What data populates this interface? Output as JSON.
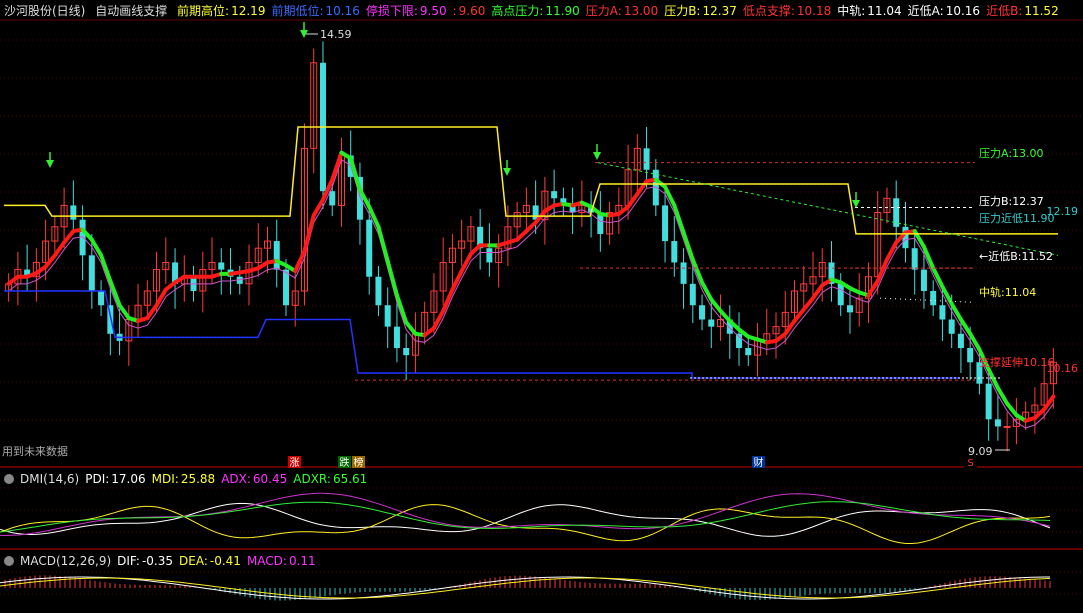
{
  "header": {
    "stock_name": "沙河股份(日线)",
    "indicator_name": "自动画线支撑",
    "items": [
      {
        "label": "前期高位:",
        "value": "12.19",
        "lc": "#ffff33",
        "vc": "#ffff33"
      },
      {
        "label": "前期低位:",
        "value": "10.16",
        "lc": "#3a6bff",
        "vc": "#3a6bff"
      },
      {
        "label": "停损下限:",
        "value": "9.50",
        "lc": "#ff33ff",
        "vc": "#ff33ff"
      },
      {
        "label": ":",
        "value": "9.60",
        "lc": "#ff3333",
        "vc": "#ff3333"
      },
      {
        "label": "高点压力:",
        "value": "11.90",
        "lc": "#33ff33",
        "vc": "#33ff33"
      },
      {
        "label": "压力A:",
        "value": "13.00",
        "lc": "#ff3333",
        "vc": "#ff3333"
      },
      {
        "label": "压力B:",
        "value": "12.37",
        "lc": "#ffff33",
        "vc": "#ffff33"
      },
      {
        "label": "低点支撑:",
        "value": "10.18",
        "lc": "#ff3333",
        "vc": "#ff3333"
      },
      {
        "label": "中轨:",
        "value": "11.04",
        "lc": "#ffffff",
        "vc": "#ffffff"
      },
      {
        "label": "近低A:",
        "value": "10.16",
        "lc": "#ffffff",
        "vc": "#ffffff"
      },
      {
        "label": "近低B:",
        "value": "11.52",
        "lc": "#ff3333",
        "vc": "#ffff33"
      }
    ]
  },
  "main_chart": {
    "high_marker": "14.59",
    "low_marker": "9.09",
    "future_data_label": "用到未来数据",
    "right_labels": [
      {
        "text": "压力A:13.00",
        "color": "#33ff33"
      },
      {
        "text": "压力B:12.37",
        "color": "#ffffff"
      },
      {
        "text": "压力近低11.90",
        "color": "#33cccc"
      },
      {
        "text": "←近低B:11.52",
        "color": "#ffffff"
      },
      {
        "text": "中轨:11.04",
        "color": "#ffff33"
      },
      {
        "text": "支撑延伸10.16",
        "color": "#ff3333"
      }
    ],
    "right_edge_values": [
      {
        "text": "12.19",
        "color": "#33cccc"
      },
      {
        "text": "10.16",
        "color": "#ff3333"
      }
    ],
    "event_markers": [
      {
        "text": "涨",
        "bg": "#cc0000",
        "fg": "#ffffff"
      },
      {
        "text": "跌",
        "bg": "#006600",
        "fg": "#ffffff"
      },
      {
        "text": "榜",
        "bg": "#996600",
        "fg": "#ffffff"
      },
      {
        "text": "财",
        "bg": "#003399",
        "fg": "#ffffff"
      },
      {
        "text": "S",
        "bg": "#000000",
        "fg": "#ff3333"
      }
    ]
  },
  "dmi": {
    "title": "DMI(14,6)",
    "items": [
      {
        "label": "PDI:",
        "value": "17.06",
        "color": "#ffffff"
      },
      {
        "label": "MDI:",
        "value": "25.88",
        "color": "#ffff33"
      },
      {
        "label": "ADX:",
        "value": "60.45",
        "color": "#ff33ff"
      },
      {
        "label": "ADXR:",
        "value": "65.61",
        "color": "#33ff33"
      }
    ]
  },
  "macd": {
    "title": "MACD(12,26,9)",
    "items": [
      {
        "label": "DIF:",
        "value": "-0.35",
        "color": "#ffffff"
      },
      {
        "label": "DEA:",
        "value": "-0.41",
        "color": "#ffff33"
      },
      {
        "label": "MACD:",
        "value": "0.11",
        "color": "#ff33ff"
      }
    ]
  },
  "chart_data": {
    "type": "candlestick",
    "title": "沙河股份(日线)",
    "price_range": [
      8.9,
      15.0
    ],
    "close_approx": [
      11.3,
      11.5,
      11.4,
      11.6,
      11.9,
      12.1,
      12.4,
      12.2,
      11.7,
      11.2,
      11.0,
      10.6,
      10.5,
      10.8,
      11.0,
      11.2,
      11.5,
      11.6,
      11.3,
      11.4,
      11.2,
      11.5,
      11.6,
      11.5,
      11.4,
      11.3,
      11.6,
      11.8,
      11.9,
      11.5,
      11.0,
      11.2,
      13.2,
      14.4,
      12.6,
      12.4,
      13.1,
      12.8,
      12.2,
      11.4,
      11.0,
      10.7,
      10.4,
      10.3,
      10.6,
      10.9,
      11.2,
      11.6,
      11.8,
      11.9,
      12.1,
      11.8,
      11.6,
      11.8,
      12.1,
      12.3,
      12.4,
      12.2,
      12.6,
      12.5,
      12.4,
      12.3,
      12.4,
      12.3,
      12.0,
      12.3,
      12.4,
      12.9,
      13.2,
      12.9,
      12.4,
      11.9,
      11.6,
      11.3,
      11.0,
      10.8,
      10.7,
      10.8,
      10.6,
      10.4,
      10.3,
      10.5,
      10.6,
      10.7,
      10.9,
      11.2,
      11.3,
      11.4,
      11.6,
      11.3,
      11.0,
      10.9,
      11.1,
      11.4,
      12.3,
      12.5,
      12.1,
      11.8,
      11.5,
      11.2,
      11.0,
      10.8,
      10.6,
      10.4,
      10.2,
      9.9,
      9.4,
      9.3,
      9.3,
      9.4,
      9.5,
      9.6,
      9.9,
      10.2
    ],
    "indicators": {
      "前期高位": 12.19,
      "前期低位": 10.16,
      "停损下限": 9.5,
      "高点压力": 11.9,
      "压力A": 13.0,
      "压力B": 12.37,
      "低点支撑": 10.18,
      "中轨": 11.04,
      "近低A": 10.16,
      "近低B": 11.52
    },
    "grid": true
  }
}
